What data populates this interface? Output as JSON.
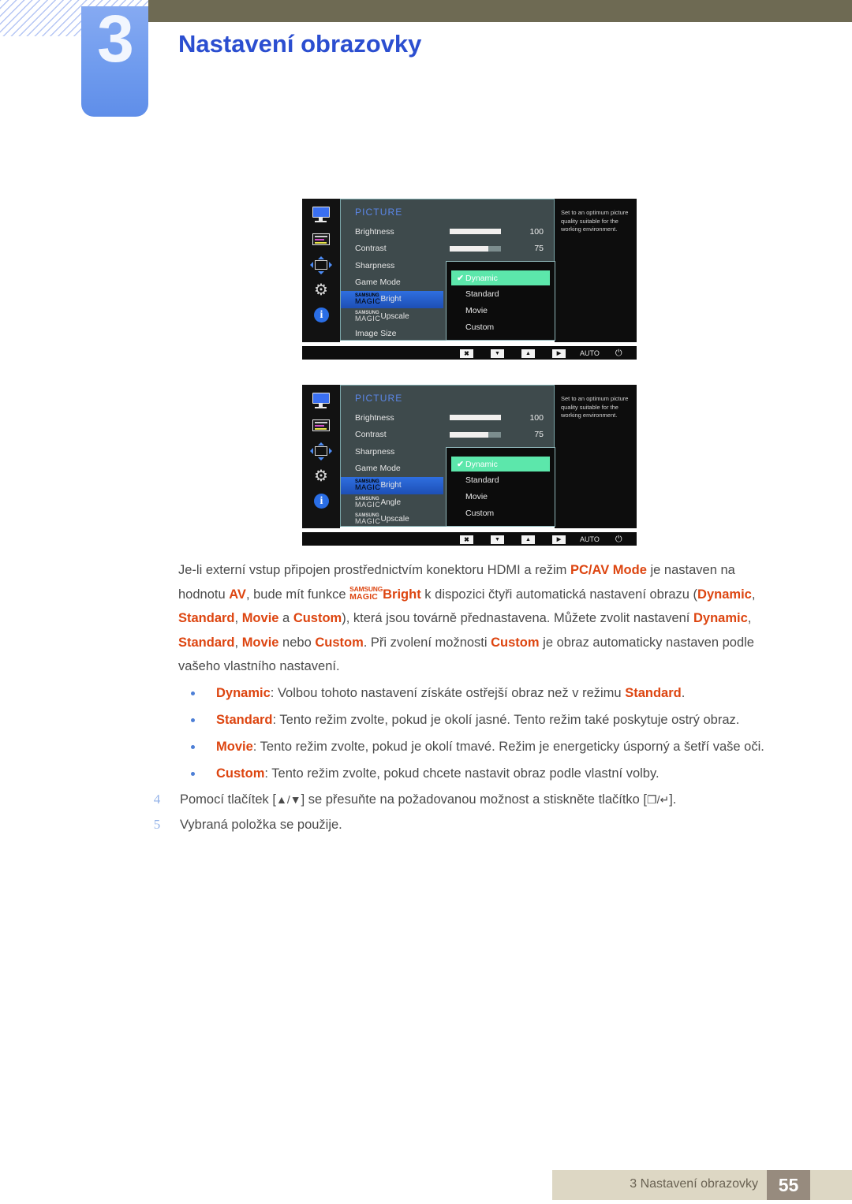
{
  "header": {
    "chapter_number": "3",
    "chapter_title": "Nastavení obrazovky"
  },
  "osd_menus": [
    {
      "title": "PICTURE",
      "rail_icons": [
        "monitor-icon",
        "color-bars-icon",
        "position-arrows-icon",
        "gear-icon",
        "info-icon"
      ],
      "items": [
        {
          "label": "Brightness",
          "type": "slider",
          "value": "100",
          "fill_pct": 100
        },
        {
          "label": "Contrast",
          "type": "slider",
          "value": "75",
          "fill_pct": 75
        },
        {
          "label": "Sharpness",
          "type": "plain"
        },
        {
          "label": "Game Mode",
          "type": "plain"
        },
        {
          "label_small": "SAMSUNG",
          "label_mid": "MAGIC",
          "label_word": "Bright",
          "type": "magic",
          "selected": true
        },
        {
          "label_small": "SAMSUNG",
          "label_mid": "MAGIC",
          "label_word": "Upscale",
          "type": "magic"
        },
        {
          "label": "Image Size",
          "type": "plain"
        }
      ],
      "dropdown": {
        "options": [
          "Dynamic",
          "Standard",
          "Movie",
          "Custom"
        ],
        "selected": "Dynamic",
        "check_glyph": "✔"
      },
      "description": "Set to an optimum picture quality suitable for the working environment.",
      "footer_buttons": [
        "✖",
        "▼",
        "▲",
        "▶"
      ],
      "footer_auto": "AUTO",
      "footer_power": "⏻"
    },
    {
      "title": "PICTURE",
      "rail_icons": [
        "monitor-icon",
        "color-bars-icon",
        "position-arrows-icon",
        "gear-icon",
        "info-icon"
      ],
      "items": [
        {
          "label": "Brightness",
          "type": "slider",
          "value": "100",
          "fill_pct": 100
        },
        {
          "label": "Contrast",
          "type": "slider",
          "value": "75",
          "fill_pct": 75
        },
        {
          "label": "Sharpness",
          "type": "plain"
        },
        {
          "label": "Game Mode",
          "type": "plain"
        },
        {
          "label_small": "SAMSUNG",
          "label_mid": "MAGIC",
          "label_word": "Bright",
          "type": "magic",
          "selected": true
        },
        {
          "label_small": "SAMSUNG",
          "label_mid": "MAGIC",
          "label_word": "Angle",
          "type": "magic"
        },
        {
          "label_small": "SAMSUNG",
          "label_mid": "MAGIC",
          "label_word": "Upscale",
          "type": "magic"
        }
      ],
      "dropdown": {
        "options": [
          "Dynamic",
          "Standard",
          "Movie",
          "Custom"
        ],
        "selected": "Dynamic",
        "check_glyph": "✔"
      },
      "description": "Set to an optimum picture quality suitable for the working environment.",
      "footer_buttons": [
        "✖",
        "▼",
        "▲",
        "▶"
      ],
      "footer_auto": "AUTO",
      "footer_power": "⏻"
    }
  ],
  "body": {
    "paragraph": {
      "p1": "Je-li externí vstup připojen prostřednictvím konektoru HDMI a režim ",
      "hl1": "PC/AV Mode",
      "p2": " je nastaven na hodnotu ",
      "hl2": "AV",
      "p3": ", bude mít funkce ",
      "magic_small": "SAMSUNG",
      "magic_mid": "MAGIC",
      "magic_word": "Bright",
      "p4": " k dispozici čtyři automatická nastavení obrazu (",
      "hl3": "Dynamic",
      "p5": ", ",
      "hl4": "Standard",
      "p6": ", ",
      "hl5": "Movie",
      "p7": " a ",
      "hl6": "Custom",
      "p8": "), která jsou továrně přednastavena. Můžete zvolit nastavení ",
      "hl7": "Dynamic",
      "p9": ", ",
      "hl8": "Standard",
      "p10": ", ",
      "hl9": "Movie",
      "p11": " nebo ",
      "hl10": "Custom",
      "p12": ". Při zvolení možnosti ",
      "hl11": "Custom",
      "p13": " je obraz automaticky nastaven podle vašeho vlastního nastavení."
    },
    "bullets": [
      {
        "term": "Dynamic",
        "text_a": ": Volbou tohoto nastavení získáte ostřejší obraz než v režimu ",
        "term_b": "Standard",
        "text_b": "."
      },
      {
        "term": "Standard",
        "text_a": ": Tento režim zvolte, pokud je okolí jasné. Tento režim také poskytuje ostrý obraz.",
        "term_b": "",
        "text_b": ""
      },
      {
        "term": "Movie",
        "text_a": ": Tento režim zvolte, pokud je okolí tmavé. Režim je energeticky úsporný a šetří vaše oči.",
        "term_b": "",
        "text_b": ""
      },
      {
        "term": "Custom",
        "text_a": ": Tento režim zvolte, pokud chcete nastavit obraz podle vlastní volby.",
        "term_b": "",
        "text_b": ""
      }
    ],
    "steps": [
      {
        "num": "4",
        "text_a": "Pomocí tlačítek [",
        "keys_a": "▲/▼",
        "text_b": "] se přesuňte na požadovanou možnost a stiskněte tlačítko [",
        "keys_b": "❐/↵",
        "text_c": "]."
      },
      {
        "num": "5",
        "text_a": "Vybraná položka se použije.",
        "keys_a": "",
        "text_b": "",
        "keys_b": "",
        "text_c": ""
      }
    ]
  },
  "footer": {
    "label": "3 Nastavení obrazovky",
    "page": "55"
  },
  "colors": {
    "topbar": "#6e6a53",
    "title_blue": "#2b4ed0",
    "badge_blue": "#6f9bee",
    "accent_orange": "#dd4510",
    "osd_green": "#5ce7ab",
    "osd_sel_blue": "#2f6fe0",
    "footer_band": "#ddd7c4",
    "footer_page": "#978b7e"
  }
}
